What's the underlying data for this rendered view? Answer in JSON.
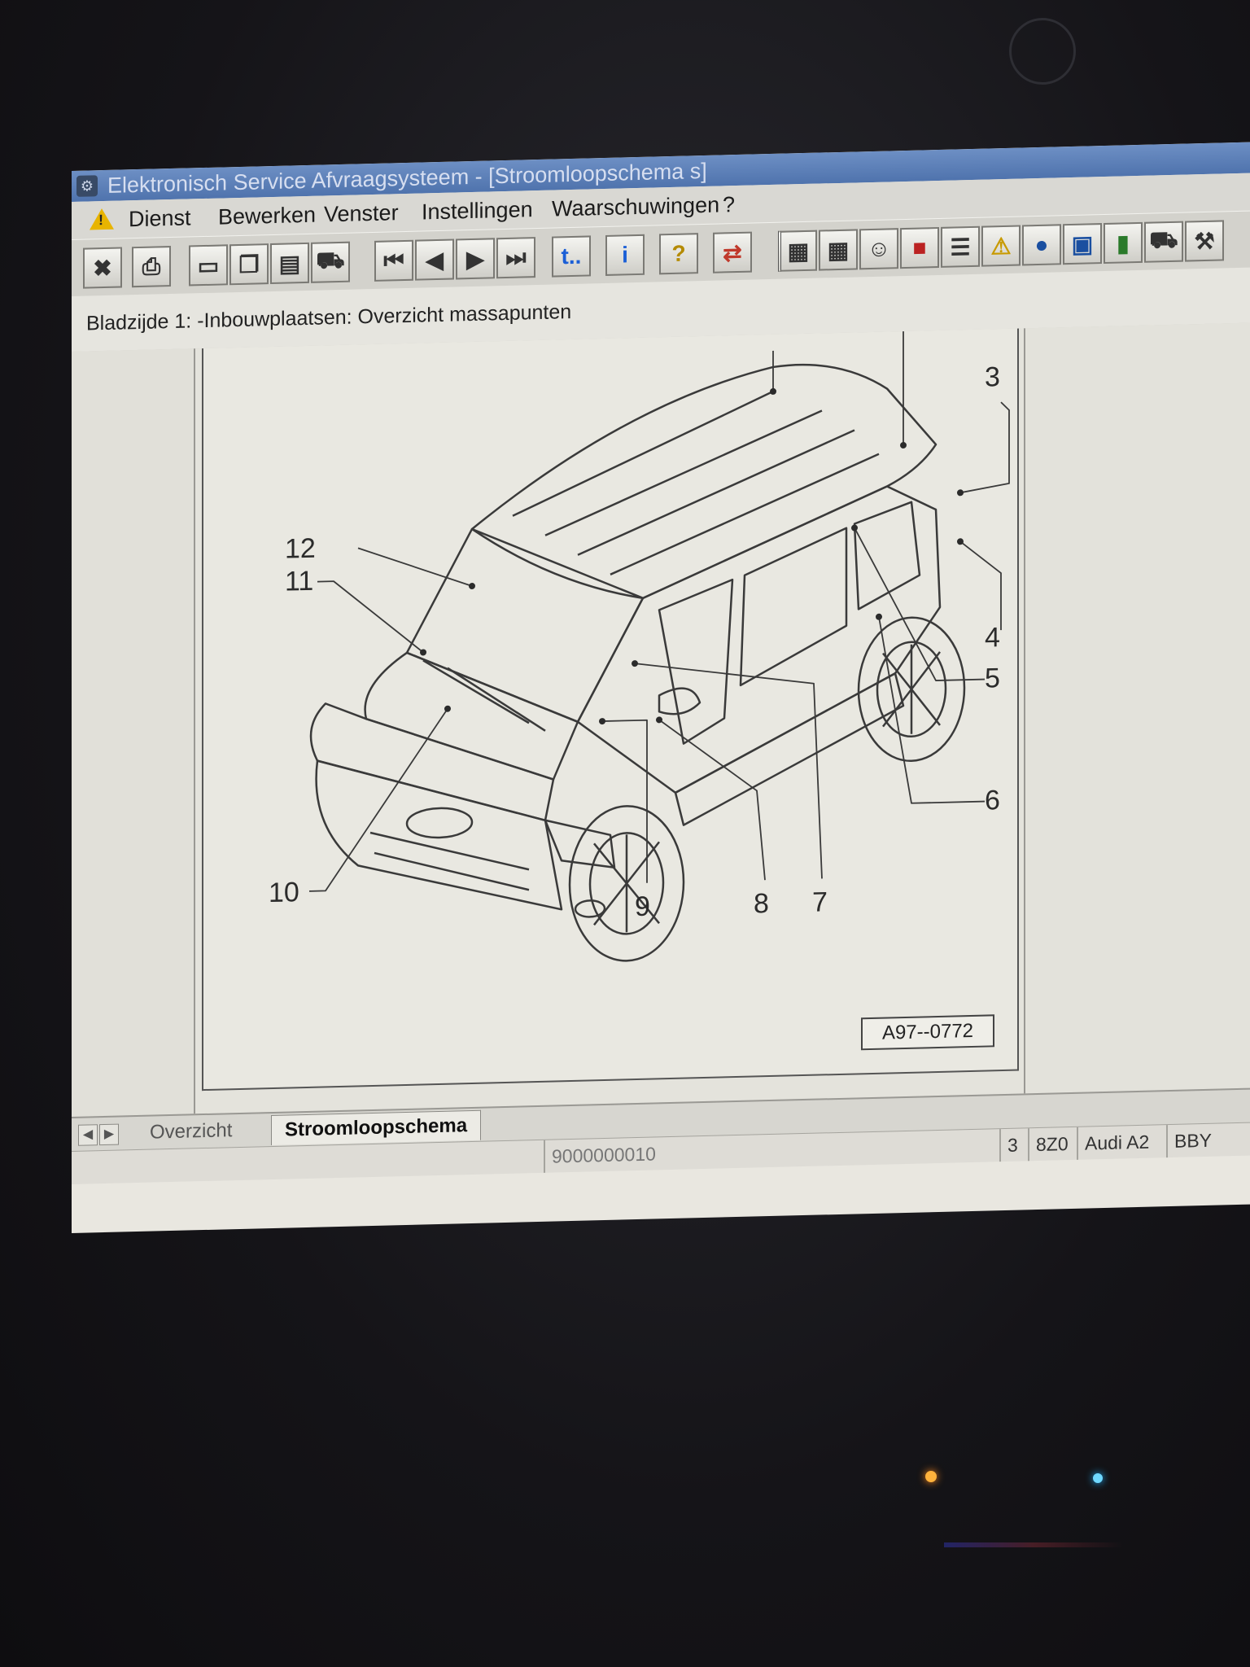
{
  "window": {
    "title": "Elektronisch Service Afvraagsysteem - [Stroomloopschema s]"
  },
  "menu": {
    "items": [
      "Dienst",
      "Bewerken",
      "Venster",
      "Instellingen",
      "Waarschuwingen",
      "?"
    ]
  },
  "toolbar": {
    "buttons": [
      "exit-icon",
      "print-icon",
      "new-page-icon",
      "copy-icon",
      "document-icon",
      "car-icon",
      "first-page-icon",
      "previous-page-icon",
      "next-page-icon",
      "last-page-icon",
      "jump-icon",
      "info-icon",
      "help-icon",
      "swap-icon",
      "grid-icon",
      "grid-2-icon",
      "person-icon",
      "book-icon",
      "list-icon",
      "warning-icon",
      "globe-icon",
      "monitor-icon",
      "battery-icon",
      "car-2-icon",
      "tool-icon"
    ],
    "jump_label": "t..",
    "info_label": "i",
    "help_label": "?"
  },
  "page_header": {
    "text": "Bladzijde 1: -Inbouwplaatsen: Overzicht massapunten"
  },
  "figure": {
    "callouts": [
      "3",
      "4",
      "5",
      "6",
      "7",
      "8",
      "9",
      "10",
      "11",
      "12"
    ],
    "image_reference": "A97--0772"
  },
  "tabs": {
    "items": [
      "Overzicht",
      "Stroomloopschema"
    ],
    "active": "Stroomloopschema"
  },
  "status": {
    "left_text": "",
    "code": "9000000010",
    "page": "3",
    "model_code": "8Z0",
    "model": "Audi A2",
    "engine": "BBY"
  },
  "colors": {
    "titlebar": "#5a7db5",
    "warning": "#e8b400",
    "info_blue": "#1b5fd6",
    "help_yellow": "#f2d23c",
    "led_orange": "#ffb23c",
    "led_blue": "#6fd8ff"
  }
}
